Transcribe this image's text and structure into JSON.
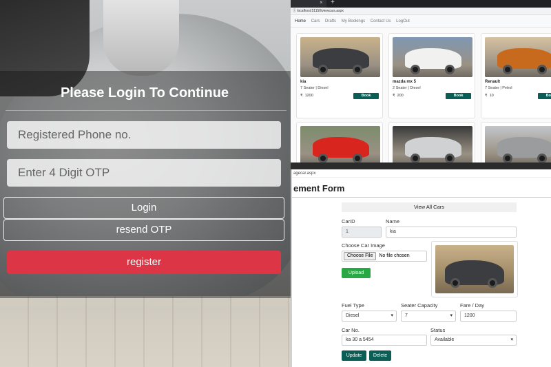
{
  "login": {
    "title": "Please Login To Continue",
    "phone_placeholder": "Registered Phone no.",
    "otp_placeholder": "Enter 4 Digit OTP",
    "login_label": "Login",
    "resend_label": "resend OTP",
    "register_label": "register",
    "colors": {
      "register": "#dc3545",
      "overlay": "rgba(20,20,20,0.42)"
    }
  },
  "browser1": {
    "tab_close": "×",
    "new_tab": "+",
    "address": "localhost:51150/viewcars.aspx",
    "nav": [
      "Home",
      "Cars",
      "Drafts",
      "My Bookings",
      "Contact Us",
      "LogOut"
    ],
    "cars": [
      {
        "name": "kia",
        "meta": "7   Seater  |  Diesel",
        "price": "1200",
        "book": "Book",
        "color": "#3b3d40",
        "sky": "#c9b28a"
      },
      {
        "name": "mazda mx 5",
        "meta": "2   Seater  |  Diesel",
        "price": "200",
        "book": "Book",
        "color": "#f1f1ef",
        "sky": "#7f98b3"
      },
      {
        "name": "Renault",
        "meta": "7   Seater  |  Petrol",
        "price": "10",
        "book": "Book",
        "color": "#c86a1e",
        "sky": "#d7c2a1"
      },
      {
        "name": "",
        "meta": "",
        "price": "",
        "book": "",
        "color": "#d8261e",
        "sky": "#7c8c6c"
      },
      {
        "name": "",
        "meta": "",
        "price": "",
        "book": "",
        "color": "#cfd1d3",
        "sky": "#3a3a3a"
      },
      {
        "name": "",
        "meta": "",
        "price": "",
        "book": "",
        "color": "#9a9c9e",
        "sky": "#c2c6c9"
      }
    ],
    "currency": "₹"
  },
  "browser2": {
    "address": "agecar.aspx",
    "heading": "ement Form",
    "view_all": "View All Cars",
    "car_id_label": "CarID",
    "car_id_value": "1",
    "name_label": "Name",
    "name_value": "kia",
    "image_label": "Choose Car Image",
    "file_button": "Choose File",
    "file_text": "No file chosen",
    "upload": "Upload",
    "fuel_label": "Fuel Type",
    "fuel_value": "Diesel",
    "seat_label": "Seater Capacity",
    "seat_value": "7",
    "fare_label": "Fare / Day",
    "fare_value": "1200",
    "carno_label": "Car No.",
    "carno_value": "ka 30 a 5454",
    "status_label": "Status",
    "status_value": "Available",
    "update": "Update",
    "delete": "Delete"
  }
}
